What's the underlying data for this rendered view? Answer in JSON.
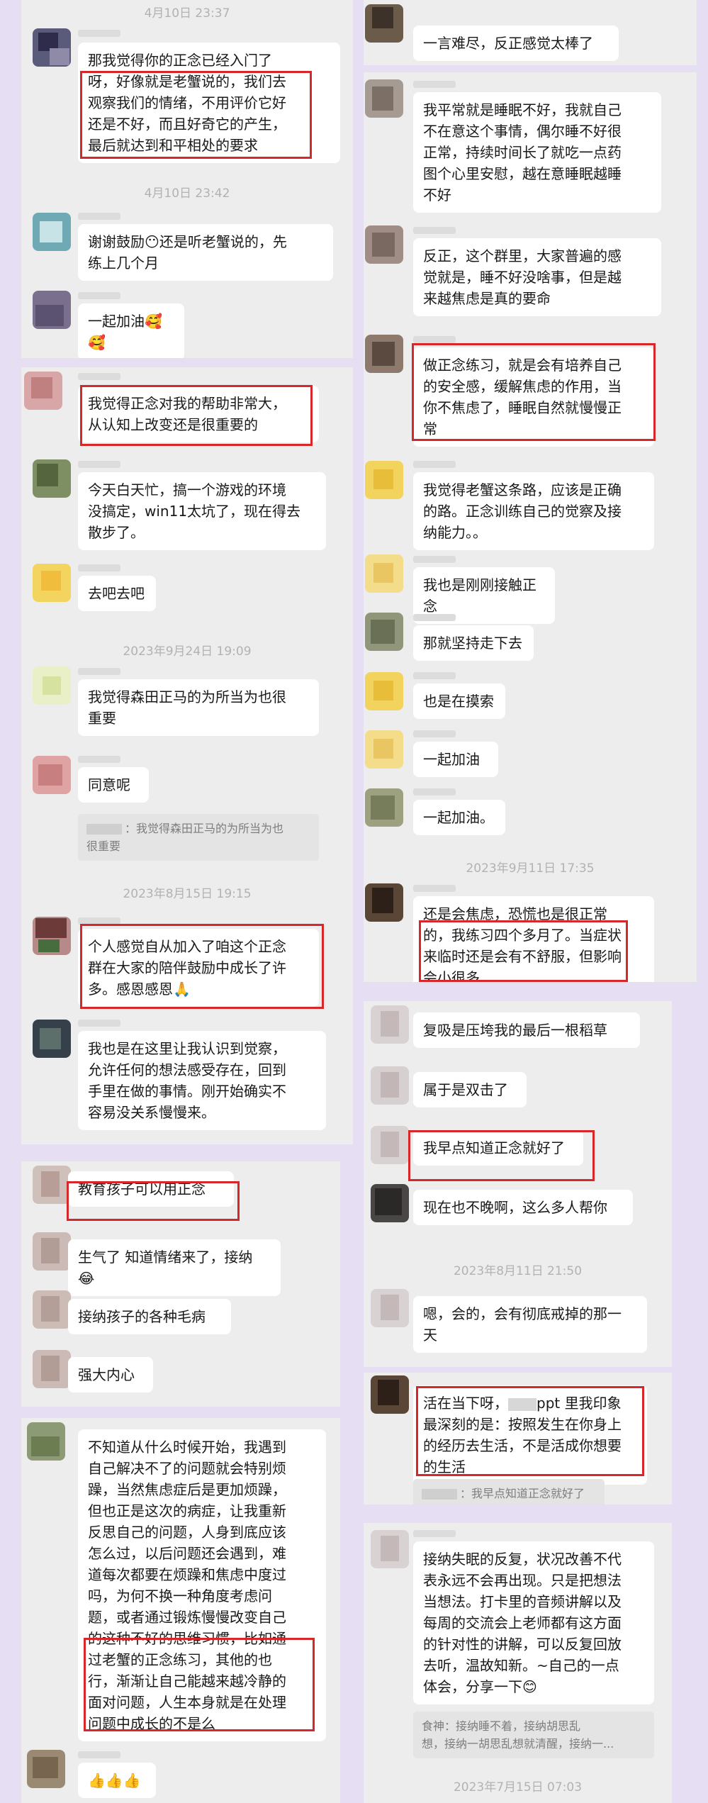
{
  "left": {
    "ts1": "4月10日 23:37",
    "b1": "那我觉得你的正念已经入门了\n呀，好像就是老蟹说的，我们去\n观察我们的情绪，不用评价它好\n还是不好，而且好奇它的产生，\n最后就达到和平相处的要求",
    "ts2": "4月10日 23:42",
    "b2": "谢谢鼓励😶还是听老蟹说的，先\n练上几个月",
    "b3": "一起加油🥰🥰",
    "b4": "我觉得正念对我的帮助非常大，\n从认知上改变还是很重要的",
    "b5": "今天白天忙，搞一个游戏的环境\n没搞定，win11太坑了，现在得去\n散步了。",
    "b6": "去吧去吧",
    "ts3": "2023年9月24日 19:09",
    "b7": "我觉得森田正马的为所当为也很\n重要",
    "b8": "同意呢",
    "q1": "：我觉得森田正马的为所当为也\n很重要",
    "ts4": "2023年8月15日 19:15",
    "b9": "个人感觉自从加入了咱这个正念\n群在大家的陪伴鼓励中成长了许\n多。感恩感恩🙏",
    "b10": "我也是在这里让我认识到觉察，\n允许任何的想法感受存在，回到\n手里在做的事情。刚开始确实不\n容易没关系慢慢来。",
    "b11": "教育孩子可以用正念",
    "b12": "生气了 知道情绪来了，接纳 😂",
    "b13": "接纳孩子的各种毛病",
    "b14": "强大内心",
    "b15": "不知道从什么时候开始，我遇到\n自己解决不了的问题就会特别烦\n躁，当然焦虑症后是更加烦躁，\n但也正是这次的病症，让我重新\n反思自己的问题，人身到底应该\n怎么过，以后问题还会遇到，难\n道每次都要在烦躁和焦虑中度过\n吗，为何不换一种角度考虑问\n题，或者通过锻炼慢慢改变自己\n的这种不好的思维习惯，比如通\n过老蟹的正念练习，其他的也\n行，渐渐让自己能越来越冷静的\n面对问题，人生本身就是在处理\n问题中成长的不是么",
    "b16": "👍👍👍"
  },
  "right": {
    "b1": "一言难尽，反正感觉太棒了",
    "b2": "我平常就是睡眠不好，我就自己\n不在意这个事情，偶尔睡不好很\n正常，持续时间长了就吃一点药\n图个心里安慰，越在意睡眠越睡\n不好",
    "b3": "反正，这个群里，大家普遍的感\n觉就是，睡不好没啥事，但是越\n来越焦虑是真的要命",
    "b4": "做正念练习，就是会有培养自己\n的安全感，缓解焦虑的作用，当\n你不焦虑了，睡眠自然就慢慢正\n常",
    "b5": "我觉得老蟹这条路，应该是正确\n的路。正念训练自己的觉察及接\n纳能力。。",
    "b6": "我也是刚刚接触正念",
    "b7": "那就坚持走下去",
    "b8": "也是在摸索",
    "b9": "一起加油",
    "b10": "一起加油。",
    "ts1": "2023年9月11日 17:35",
    "b11": "还是会焦虑，恐慌也是很正常\n的，我练习四个多月了。当症状\n来临时还是会有不舒服，但影响\n会小很多",
    "b12": "复吸是压垮我的最后一根稻草",
    "b13": "属于是双击了",
    "b14": "我早点知道正念就好了",
    "b15": "现在也不晚啊，这么多人帮你",
    "ts2": "2023年8月11日 21:50",
    "b16": "嗯，会的，会有彻底戒掉的那一\n天",
    "b17_a": "活在当下呀，",
    "b17_b": "ppt 里我印象\n最深刻的是：按照发生在你身上\n的经历去生活，不是活成你想要\n的生活",
    "q1": "：我早点知道正念就好了",
    "b18": "接纳失眠的反复，状况改善不代\n表永远不会再出现。只是把想法\n当想法。打卡里的音频讲解以及\n每周的交流会上老师都有这方面\n的针对性的讲解，可以反复回放\n去听，温故知新。~自己的一点\n体会，分享一下😊",
    "q2": "食神：接纳睡不着，接纳胡思乱\n想，接纳一胡思乱想就清醒，接纳一...",
    "ts3": "2023年7月15日 07:03"
  },
  "colors": {
    "highlight": "#d6272a",
    "bubble": "#ffffff",
    "panel": "#ededed",
    "background": "#e6dff3"
  }
}
